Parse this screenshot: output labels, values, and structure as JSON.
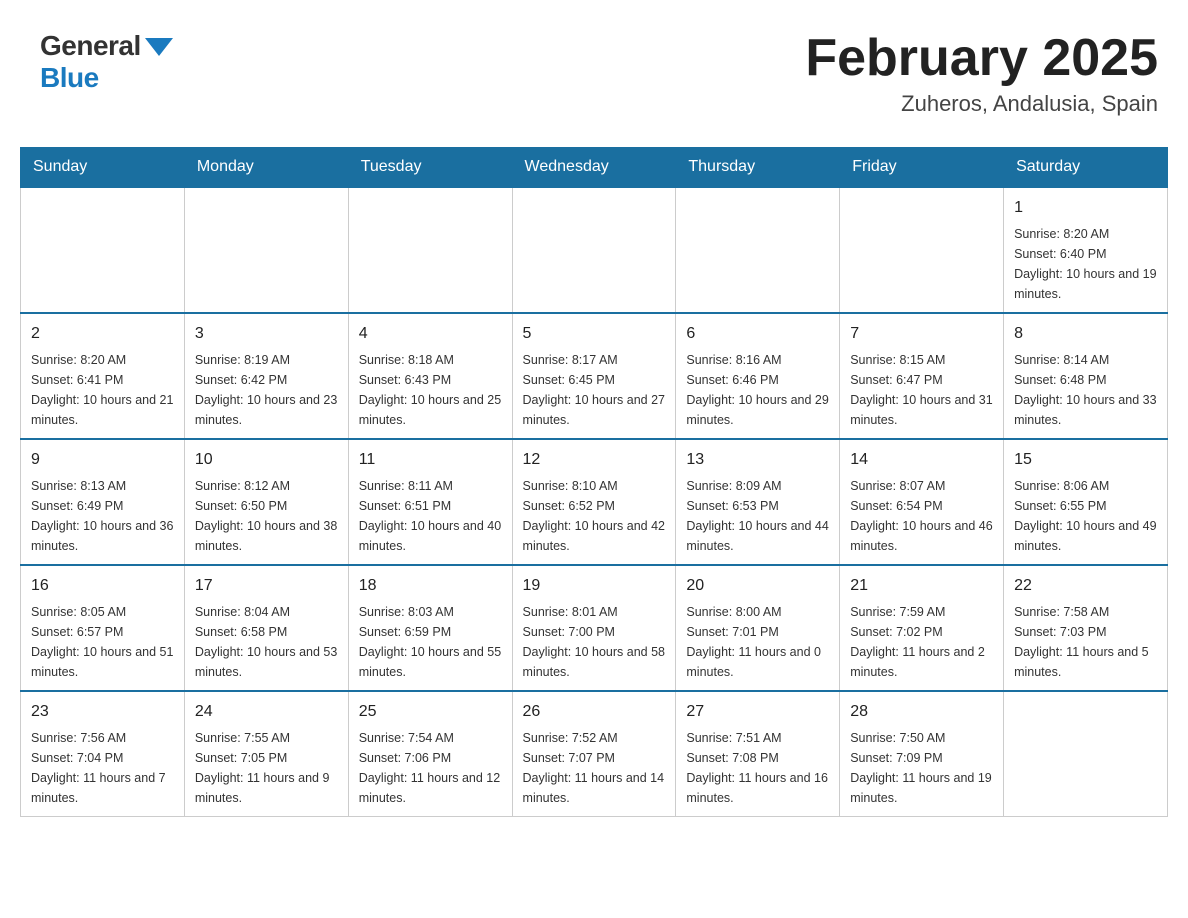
{
  "header": {
    "logo_general": "General",
    "logo_blue": "Blue",
    "month_title": "February 2025",
    "location": "Zuheros, Andalusia, Spain"
  },
  "weekdays": [
    "Sunday",
    "Monday",
    "Tuesday",
    "Wednesday",
    "Thursday",
    "Friday",
    "Saturday"
  ],
  "weeks": [
    [
      {
        "day": "",
        "info": ""
      },
      {
        "day": "",
        "info": ""
      },
      {
        "day": "",
        "info": ""
      },
      {
        "day": "",
        "info": ""
      },
      {
        "day": "",
        "info": ""
      },
      {
        "day": "",
        "info": ""
      },
      {
        "day": "1",
        "info": "Sunrise: 8:20 AM\nSunset: 6:40 PM\nDaylight: 10 hours and 19 minutes."
      }
    ],
    [
      {
        "day": "2",
        "info": "Sunrise: 8:20 AM\nSunset: 6:41 PM\nDaylight: 10 hours and 21 minutes."
      },
      {
        "day": "3",
        "info": "Sunrise: 8:19 AM\nSunset: 6:42 PM\nDaylight: 10 hours and 23 minutes."
      },
      {
        "day": "4",
        "info": "Sunrise: 8:18 AM\nSunset: 6:43 PM\nDaylight: 10 hours and 25 minutes."
      },
      {
        "day": "5",
        "info": "Sunrise: 8:17 AM\nSunset: 6:45 PM\nDaylight: 10 hours and 27 minutes."
      },
      {
        "day": "6",
        "info": "Sunrise: 8:16 AM\nSunset: 6:46 PM\nDaylight: 10 hours and 29 minutes."
      },
      {
        "day": "7",
        "info": "Sunrise: 8:15 AM\nSunset: 6:47 PM\nDaylight: 10 hours and 31 minutes."
      },
      {
        "day": "8",
        "info": "Sunrise: 8:14 AM\nSunset: 6:48 PM\nDaylight: 10 hours and 33 minutes."
      }
    ],
    [
      {
        "day": "9",
        "info": "Sunrise: 8:13 AM\nSunset: 6:49 PM\nDaylight: 10 hours and 36 minutes."
      },
      {
        "day": "10",
        "info": "Sunrise: 8:12 AM\nSunset: 6:50 PM\nDaylight: 10 hours and 38 minutes."
      },
      {
        "day": "11",
        "info": "Sunrise: 8:11 AM\nSunset: 6:51 PM\nDaylight: 10 hours and 40 minutes."
      },
      {
        "day": "12",
        "info": "Sunrise: 8:10 AM\nSunset: 6:52 PM\nDaylight: 10 hours and 42 minutes."
      },
      {
        "day": "13",
        "info": "Sunrise: 8:09 AM\nSunset: 6:53 PM\nDaylight: 10 hours and 44 minutes."
      },
      {
        "day": "14",
        "info": "Sunrise: 8:07 AM\nSunset: 6:54 PM\nDaylight: 10 hours and 46 minutes."
      },
      {
        "day": "15",
        "info": "Sunrise: 8:06 AM\nSunset: 6:55 PM\nDaylight: 10 hours and 49 minutes."
      }
    ],
    [
      {
        "day": "16",
        "info": "Sunrise: 8:05 AM\nSunset: 6:57 PM\nDaylight: 10 hours and 51 minutes."
      },
      {
        "day": "17",
        "info": "Sunrise: 8:04 AM\nSunset: 6:58 PM\nDaylight: 10 hours and 53 minutes."
      },
      {
        "day": "18",
        "info": "Sunrise: 8:03 AM\nSunset: 6:59 PM\nDaylight: 10 hours and 55 minutes."
      },
      {
        "day": "19",
        "info": "Sunrise: 8:01 AM\nSunset: 7:00 PM\nDaylight: 10 hours and 58 minutes."
      },
      {
        "day": "20",
        "info": "Sunrise: 8:00 AM\nSunset: 7:01 PM\nDaylight: 11 hours and 0 minutes."
      },
      {
        "day": "21",
        "info": "Sunrise: 7:59 AM\nSunset: 7:02 PM\nDaylight: 11 hours and 2 minutes."
      },
      {
        "day": "22",
        "info": "Sunrise: 7:58 AM\nSunset: 7:03 PM\nDaylight: 11 hours and 5 minutes."
      }
    ],
    [
      {
        "day": "23",
        "info": "Sunrise: 7:56 AM\nSunset: 7:04 PM\nDaylight: 11 hours and 7 minutes."
      },
      {
        "day": "24",
        "info": "Sunrise: 7:55 AM\nSunset: 7:05 PM\nDaylight: 11 hours and 9 minutes."
      },
      {
        "day": "25",
        "info": "Sunrise: 7:54 AM\nSunset: 7:06 PM\nDaylight: 11 hours and 12 minutes."
      },
      {
        "day": "26",
        "info": "Sunrise: 7:52 AM\nSunset: 7:07 PM\nDaylight: 11 hours and 14 minutes."
      },
      {
        "day": "27",
        "info": "Sunrise: 7:51 AM\nSunset: 7:08 PM\nDaylight: 11 hours and 16 minutes."
      },
      {
        "day": "28",
        "info": "Sunrise: 7:50 AM\nSunset: 7:09 PM\nDaylight: 11 hours and 19 minutes."
      },
      {
        "day": "",
        "info": ""
      }
    ]
  ]
}
